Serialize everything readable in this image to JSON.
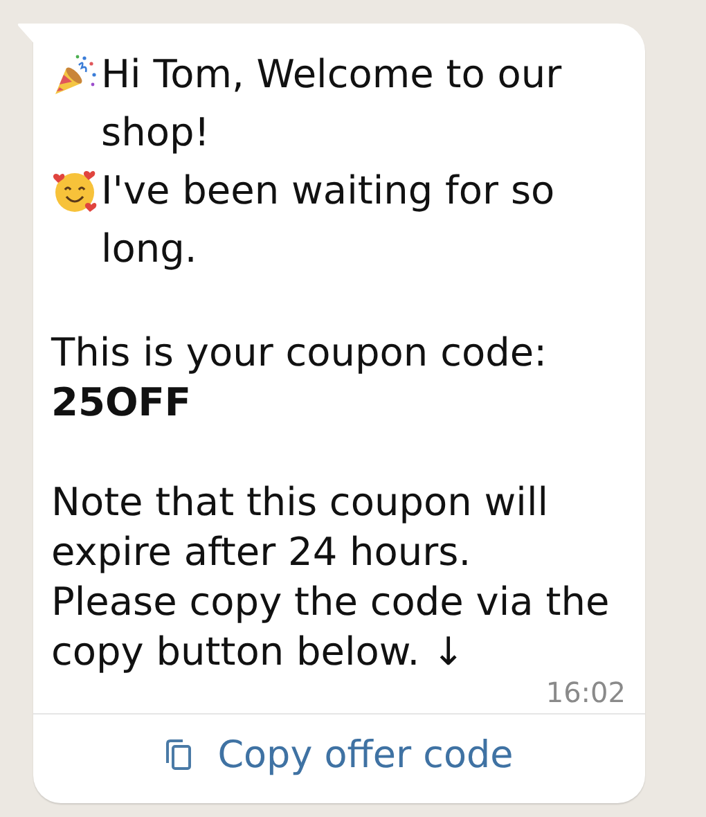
{
  "message": {
    "paragraphs": [
      {
        "text": "Hi Tom, Welcome to our shop!"
      },
      {
        "text": "I've been waiting for so long."
      },
      {
        "text": "This is your coupon code:\n**25OFF**"
      },
      {
        "text": "Note that this coupon will expire after 24 hours.\nPlease copy the code via the copy button below. ↓"
      }
    ],
    "time": "16:02",
    "buttons": [
      {
        "kind": "copy",
        "label": "Copy offer code"
      }
    ]
  }
}
